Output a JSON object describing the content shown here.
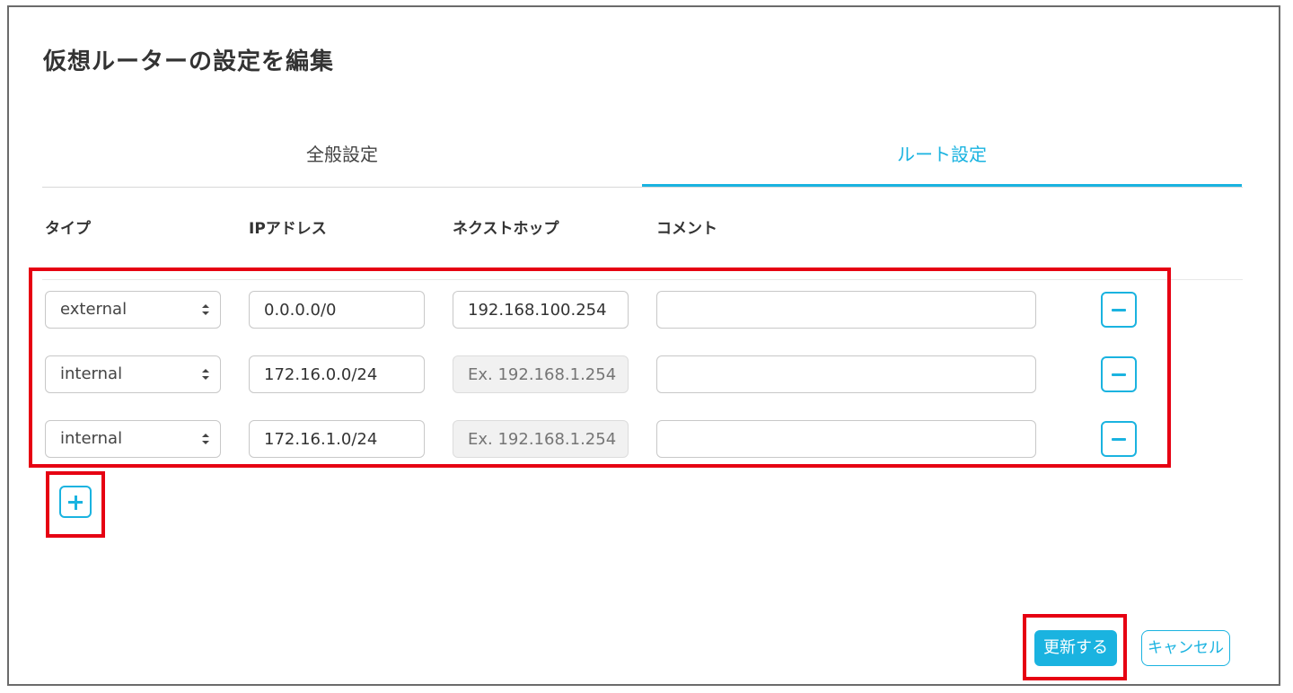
{
  "dialog": {
    "title": "仮想ルーターの設定を編集"
  },
  "tabs": [
    {
      "label": "全般設定",
      "active": false
    },
    {
      "label": "ルート設定",
      "active": true
    }
  ],
  "table": {
    "headers": [
      "タイプ",
      "IPアドレス",
      "ネクストホップ",
      "コメント"
    ],
    "rows": [
      {
        "type": "external",
        "ip": "0.0.0.0/0",
        "next_hop": "192.168.100.254",
        "next_hop_placeholder": "",
        "next_hop_disabled": false,
        "comment": ""
      },
      {
        "type": "internal",
        "ip": "172.16.0.0/24",
        "next_hop": "",
        "next_hop_placeholder": "Ex. 192.168.1.254",
        "next_hop_disabled": true,
        "comment": ""
      },
      {
        "type": "internal",
        "ip": "172.16.1.0/24",
        "next_hop": "",
        "next_hop_placeholder": "Ex. 192.168.1.254",
        "next_hop_disabled": true,
        "comment": ""
      }
    ]
  },
  "buttons": {
    "update": "更新する",
    "cancel": "キャンセル"
  },
  "colors": {
    "accent": "#1ab3e0",
    "highlight": "#e60012",
    "border": "#c8c8c8"
  },
  "icons": {
    "remove_row": "minus-icon",
    "add_row": "plus-icon",
    "select_caret": "sort-caret-icon"
  }
}
